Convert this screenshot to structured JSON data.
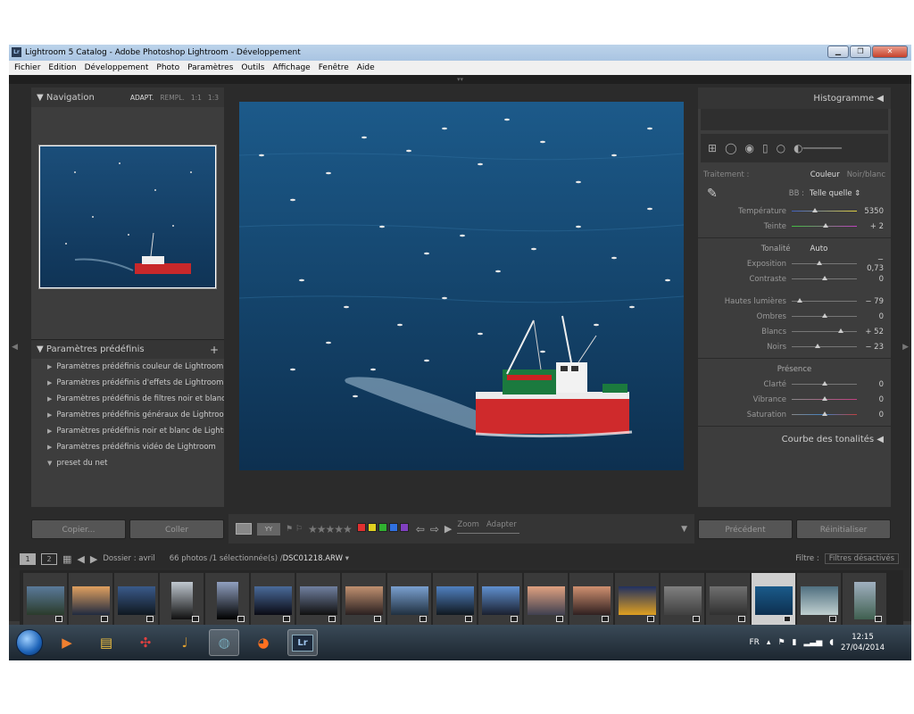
{
  "window": {
    "title": "Lightroom 5 Catalog - Adobe Photoshop Lightroom - Développement",
    "app_icon": "Lr"
  },
  "menu": [
    "Fichier",
    "Edition",
    "Développement",
    "Photo",
    "Paramètres",
    "Outils",
    "Affichage",
    "Fenêtre",
    "Aide"
  ],
  "navigator": {
    "title": "Navigation",
    "options": [
      "ADAPT.",
      "REMPL.",
      "1:1",
      "1:3"
    ]
  },
  "presets": {
    "title": "Paramètres prédéfinis",
    "add": "+",
    "items": [
      "Paramètres prédéfinis couleur de Lightroom",
      "Paramètres prédéfinis d'effets de Lightroom",
      "Paramètres prédéfinis de filtres noir et blanc d...",
      "Paramètres prédéfinis généraux de Lightroom",
      "Paramètres prédéfinis noir et blanc de Lightro...",
      "Paramètres prédéfinis vidéo de Lightroom",
      "preset du net"
    ]
  },
  "left_buttons": {
    "copy": "Copier...",
    "paste": "Coller"
  },
  "toolbar": {
    "zoom_label": "Zoom",
    "zoom_value": "Adapter",
    "stars": "★★★★★",
    "colors": [
      "#e03030",
      "#e0d020",
      "#30b030",
      "#3070e0",
      "#8040c0"
    ]
  },
  "histogram": {
    "title": "Histogramme"
  },
  "basic": {
    "treatment_label": "Traitement :",
    "color": "Couleur",
    "bw": "Noir/blanc",
    "wb_label": "BB :",
    "wb_value": "Telle quelle",
    "temp": {
      "label": "Température",
      "value": "5350",
      "pos": 0.35
    },
    "tint": {
      "label": "Teinte",
      "value": "+ 2",
      "pos": 0.52
    },
    "tone_label": "Tonalité",
    "auto": "Auto",
    "exposure": {
      "label": "Exposition",
      "value": "− 0,73",
      "pos": 0.42
    },
    "contrast": {
      "label": "Contraste",
      "value": "0",
      "pos": 0.5
    },
    "highlights": {
      "label": "Hautes lumières",
      "value": "− 79",
      "pos": 0.12
    },
    "shadows": {
      "label": "Ombres",
      "value": "0",
      "pos": 0.5
    },
    "whites": {
      "label": "Blancs",
      "value": "+ 52",
      "pos": 0.76
    },
    "blacks": {
      "label": "Noirs",
      "value": "− 23",
      "pos": 0.4
    },
    "presence_label": "Présence",
    "clarity": {
      "label": "Clarté",
      "value": "0",
      "pos": 0.5
    },
    "vibrance": {
      "label": "Vibrance",
      "value": "0",
      "pos": 0.5
    },
    "saturation": {
      "label": "Saturation",
      "value": "0",
      "pos": 0.5
    }
  },
  "tone_curve": {
    "title": "Courbe des tonalités"
  },
  "right_buttons": {
    "previous": "Précédent",
    "reset": "Réinitialiser"
  },
  "filmstrip_bar": {
    "page1": "1",
    "page2": "2",
    "folder": "Dossier : avril",
    "count": "66 photos /1 sélectionnée(s) /",
    "file": "DSC01218.ARW",
    "filter_label": "Filtre :",
    "filter_value": "Filtres désactivés"
  },
  "taskbar": {
    "lang": "FR",
    "time": "12:15",
    "date": "27/04/2014",
    "lr": "Lr"
  }
}
